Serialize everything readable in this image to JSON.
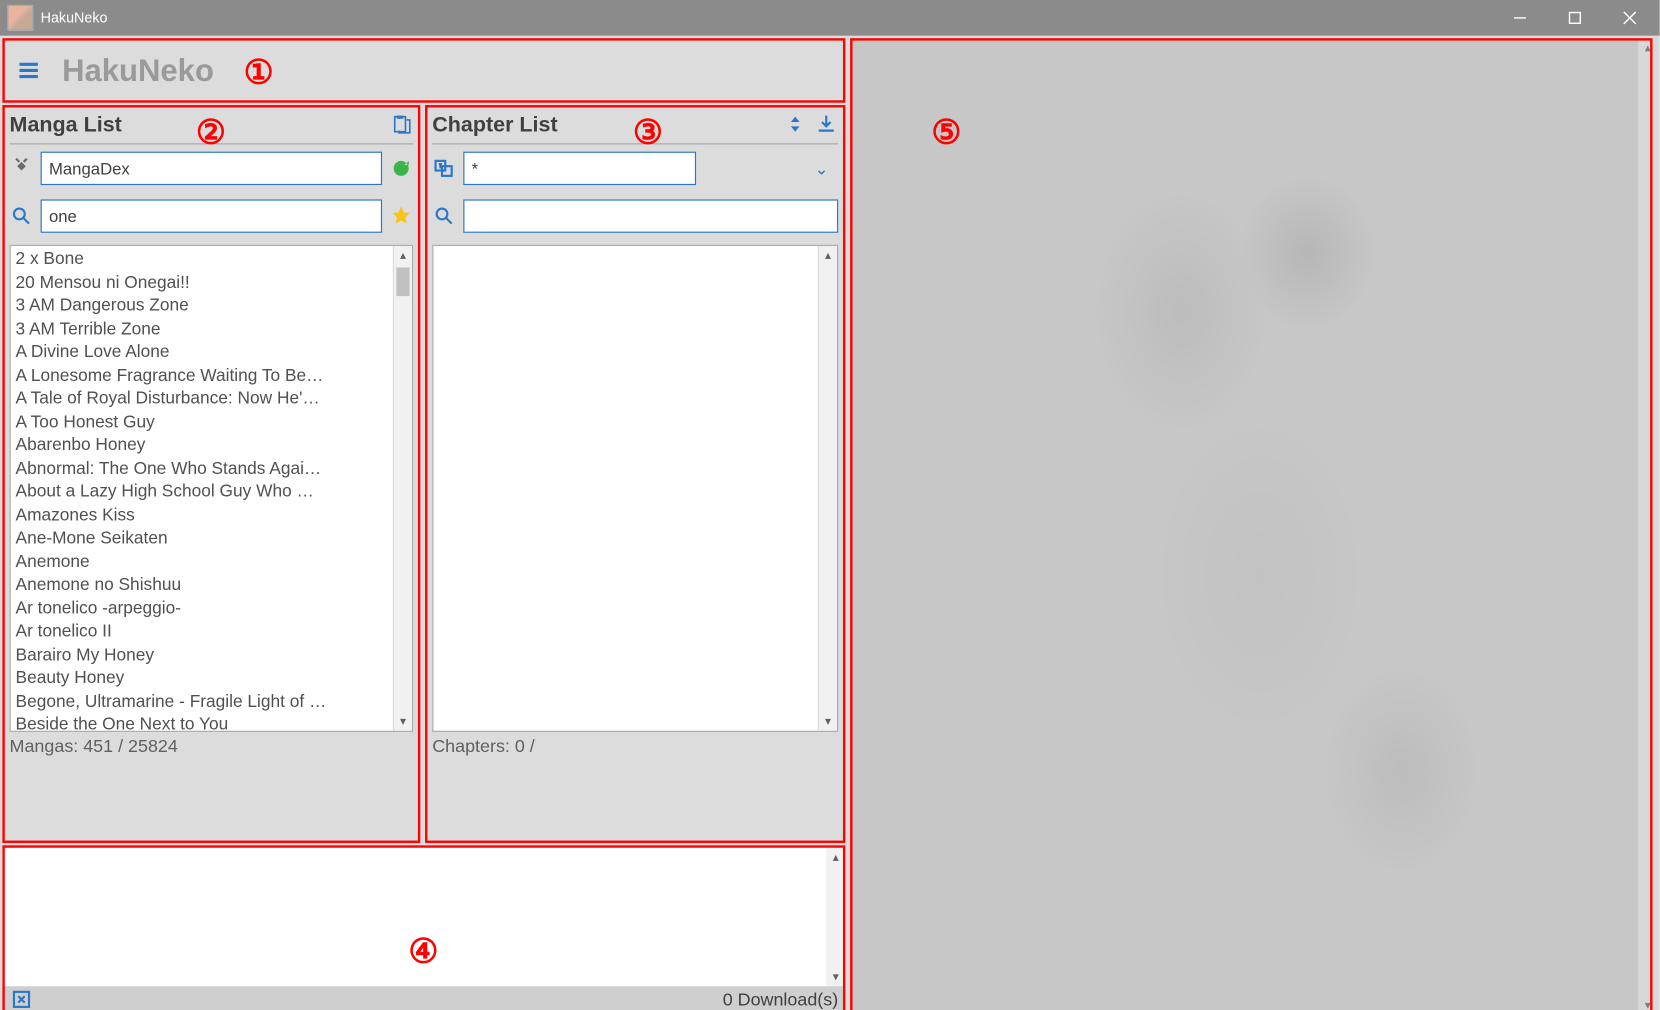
{
  "window": {
    "title": "HakuNeko"
  },
  "toolbar": {
    "app_title": "HakuNeko"
  },
  "annotations": {
    "a1": "①",
    "a2": "②",
    "a3": "③",
    "a4": "④",
    "a5": "⑤"
  },
  "manga_panel": {
    "title": "Manga List",
    "source_value": "MangaDex",
    "search_value": "one",
    "status": "Mangas: 451 / 25824",
    "items": [
      "2 x Bone",
      "20 Mensou ni Onegai!!",
      "3 AM Dangerous Zone",
      "3 AM Terrible Zone",
      "A Divine Love Alone",
      "A Lonesome Fragrance Waiting To Be…",
      "A Tale of Royal Disturbance: Now He'…",
      "A Too Honest Guy",
      "Abarenbo Honey",
      "Abnormal: The One Who Stands Agai…",
      "About a Lazy High School Guy Who …",
      "Amazones Kiss",
      "Ane-Mone Seikaten",
      "Anemone",
      "Anemone no Shishuu",
      "Ar tonelico -arpeggio-",
      "Ar tonelico II",
      "Barairo My Honey",
      "Beauty Honey",
      "Begone, Ultramarine - Fragile Light of …",
      "Beside the One Next to You"
    ]
  },
  "chapter_panel": {
    "title": "Chapter List",
    "language_value": "*",
    "search_value": "",
    "status": "Chapters: 0 /"
  },
  "downloads": {
    "label": "0 Download(s)"
  }
}
